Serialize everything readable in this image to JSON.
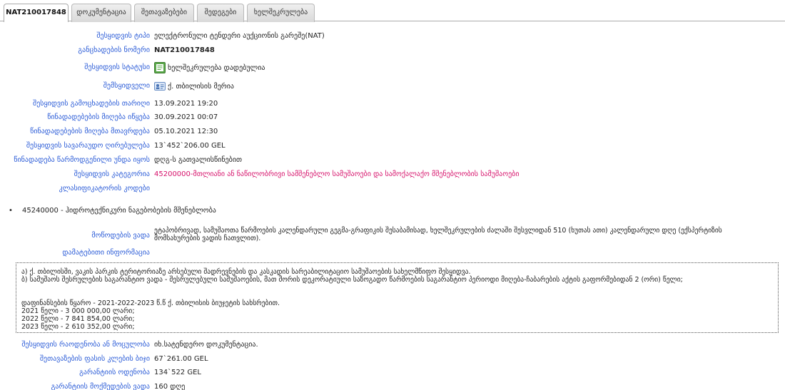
{
  "tabs": [
    {
      "label": "NAT210017848",
      "active": true
    },
    {
      "label": "დოკუმენტაცია",
      "active": false
    },
    {
      "label": "შეთავაზებები",
      "active": false
    },
    {
      "label": "შედეგები",
      "active": false
    },
    {
      "label": "ხელშეკრულება",
      "active": false
    }
  ],
  "fields": {
    "type": {
      "label": "შესყიდვის ტიპი",
      "value": "ელექტრონული ტენდერი აუქციონის გარეშე(NAT)"
    },
    "number": {
      "label": "განცხადების ნომერი",
      "value": "NAT210017848"
    },
    "status": {
      "label": "შესყიდვის სტატუსი",
      "value": "ხელშეკრულება დადებულია",
      "icon": "contract-document-icon"
    },
    "buyer": {
      "label": "შემსყიდველი",
      "value": "ქ. თბილისის მერია",
      "icon": "organization-card-icon"
    },
    "announce_date": {
      "label": "შესყიდვის გამოცხადების თარიღი",
      "value": "13.09.2021 19:20"
    },
    "bid_start": {
      "label": "წინადადებების მიღება იწყება",
      "value": "30.09.2021 00:07"
    },
    "bid_end": {
      "label": "წინადადებების მიღება მთავრდება",
      "value": "05.10.2021 12:30"
    },
    "estimated_value": {
      "label": "შესყიდვის სავარაუდო ღირებულება",
      "value": "13`452`206.00 GEL"
    },
    "bid_validity": {
      "label": "წინადადება წარმოდგენილი უნდა იყოს",
      "value": "დღგ-ს გათვალისწინებით"
    },
    "category": {
      "label": "შესყიდვის კატეგორია",
      "value": "45200000-მთლიანი ან ნაწილობრივი სამშენებლო სამუშაოები და სამოქალაქო მშენებლობის სამუშაოები"
    },
    "classifier": {
      "label": "კლასიფიკატორის კოდები",
      "value": ""
    }
  },
  "classifier_items": [
    "45240000 - ჰიდროტექნიკური ნაგებობების მშენებლობა"
  ],
  "delivery": {
    "label": "მოწოდების ვადა",
    "value": "ეტაპობრივად, სამუშაოთა წარმოების კალენდარული გეგმა-გრაფიკის შესაბამისად, ხელშეკრულების ძალაში შესვლიდან 510 (ხუთას ათი) კალენდარული დღე (ექსპერტიზის მომსახურების ვადის ჩათვლით)."
  },
  "additional_info": {
    "label": "დამატებითი ინფორმაცია",
    "lines": [
      "ა) ქ. თბილისში, ვაკის პარკის ტერიტორიაზე არსებული შადრევნების და კასკადის სარეაბილიტაციო სამუშაოების სახელმწიფო შესყიდვა.",
      "ბ) სამუშაოს შესრულების საგარანტიო ვადა - შესრულებული სამუშაოების, მათ შორის დეკორატიული საზოგადო წარმოების საგარანტიო პერიოდი მიღება-ჩაბარების აქტის გაფორმებიდან 2 (ორი) წელი;",
      "",
      "",
      "დაფინანსების წყარო - 2021-2022-2023 წ.წ ქ. თბილისის ბიუჯეტის სახსრებით.",
      "2021 წელი - 3 000 000,00 ლარი;",
      "2022 წელი - 7 841 854,00 ლარი;",
      "2023 წელი - 2 610 352,00 ლარი;"
    ]
  },
  "bottom_fields": {
    "quantity": {
      "label": "შესყიდვის რაოდენობა ან მოცულობა",
      "value": "იხ.სატენდერო დოკუმენტაცია."
    },
    "price_step": {
      "label": "შეთავაზების ფასის კლების ბიჯი",
      "value": "67`261.00 GEL"
    },
    "guarantee_amount": {
      "label": "გარანტიის ოდენობა",
      "value": "134`522 GEL"
    },
    "guarantee_period": {
      "label": "გარანტიის მოქმედების ვადა",
      "value": "160 დღე"
    }
  }
}
